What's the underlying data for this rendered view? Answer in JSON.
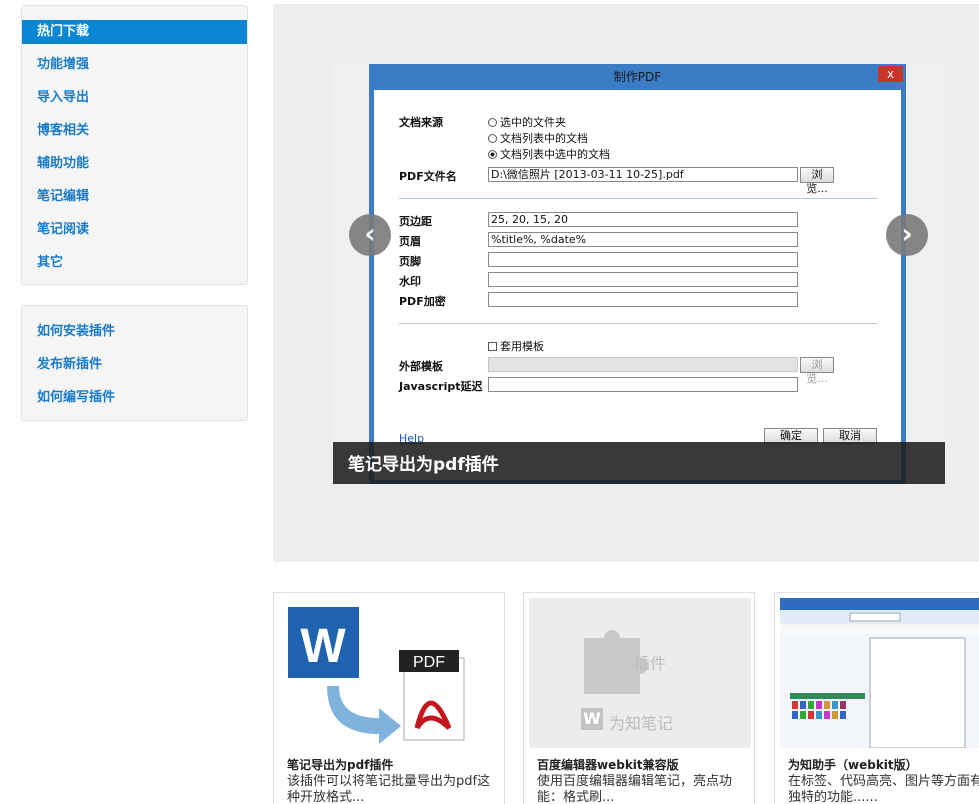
{
  "sidebar": {
    "group1": [
      "热门下载",
      "功能增强",
      "导入导出",
      "博客相关",
      "辅助功能",
      "笔记编辑",
      "笔记阅读",
      "其它"
    ],
    "group2": [
      "如何安装插件",
      "发布新插件",
      "如何编写插件"
    ]
  },
  "carousel": {
    "caption": "笔记导出为pdf插件",
    "prev": "‹",
    "next": "›",
    "dialog": {
      "title": "制作PDF",
      "close": "x",
      "doc_source_label": "文档来源",
      "radio1": "选中的文件夹",
      "radio2": "文档列表中的文档",
      "radio3": "文档列表中选中的文档",
      "pdf_name_label": "PDF文件名",
      "pdf_name_value": "D:\\微信照片 [2013-03-11 10-25].pdf",
      "browse": "浏览...",
      "margin_label": "页边距",
      "margin_value": "25, 20, 15, 20",
      "header_label": "页眉",
      "header_value": "%title%, %date%",
      "footer_label": "页脚",
      "watermark_label": "水印",
      "encrypt_label": "PDF加密",
      "template_check": "套用模板",
      "ext_template_label": "外部模板",
      "browse2": "浏览...",
      "js_delay_label": "Javascript延迟",
      "help": "Help",
      "ok": "确定",
      "cancel": "取消"
    }
  },
  "cards": [
    {
      "title": "笔记导出为pdf插件",
      "desc": "该插件可以将笔记批量导出为pdf这种开放格式..."
    },
    {
      "title": "百度编辑器webkit兼容版",
      "desc": "使用百度编辑器编辑笔记，亮点功能：格式刷...",
      "thumb_text1": "插件",
      "thumb_text2": "为知笔记"
    },
    {
      "title": "为知助手（webkit版）",
      "desc": "在标签、代码高亮、图片等方面有独特的功能......"
    }
  ],
  "colors": {
    "active": "#0b86d4",
    "link": "#1a7cc9"
  }
}
